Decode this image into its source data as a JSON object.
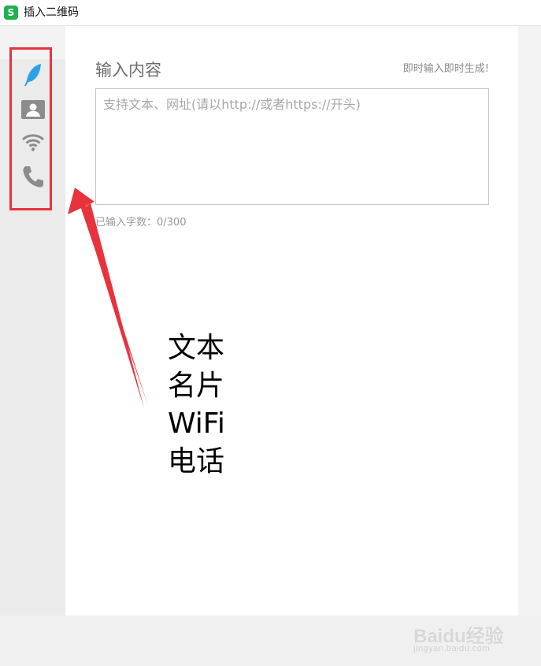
{
  "window": {
    "title": "插入二维码",
    "app_icon_letter": "S",
    "app_icon_color": "#1fb14e"
  },
  "sidebar": {
    "items": [
      {
        "name": "text",
        "icon": "feather-icon",
        "color": "#2aa3e6",
        "active": true
      },
      {
        "name": "card",
        "icon": "contact-card-icon",
        "color": "#8c8c8c"
      },
      {
        "name": "wifi",
        "icon": "wifi-icon",
        "color": "#8c8c8c"
      },
      {
        "name": "phone",
        "icon": "phone-icon",
        "color": "#8c8c8c"
      }
    ],
    "highlight_color": "#e8333d"
  },
  "main": {
    "section_title": "输入内容",
    "hint": "即时输入即时生成!",
    "textarea_placeholder": "支持文本、网址(请以http://或者https://开头)",
    "textarea_value": "",
    "counter": "已输入字数：0/300"
  },
  "annotation": {
    "lines": [
      "文本",
      "名片",
      "WiFi",
      "电话"
    ],
    "arrow_color": "#e8333d"
  },
  "watermark": {
    "main": "Baidu经验",
    "sub": "jingyan.baidu.com"
  }
}
